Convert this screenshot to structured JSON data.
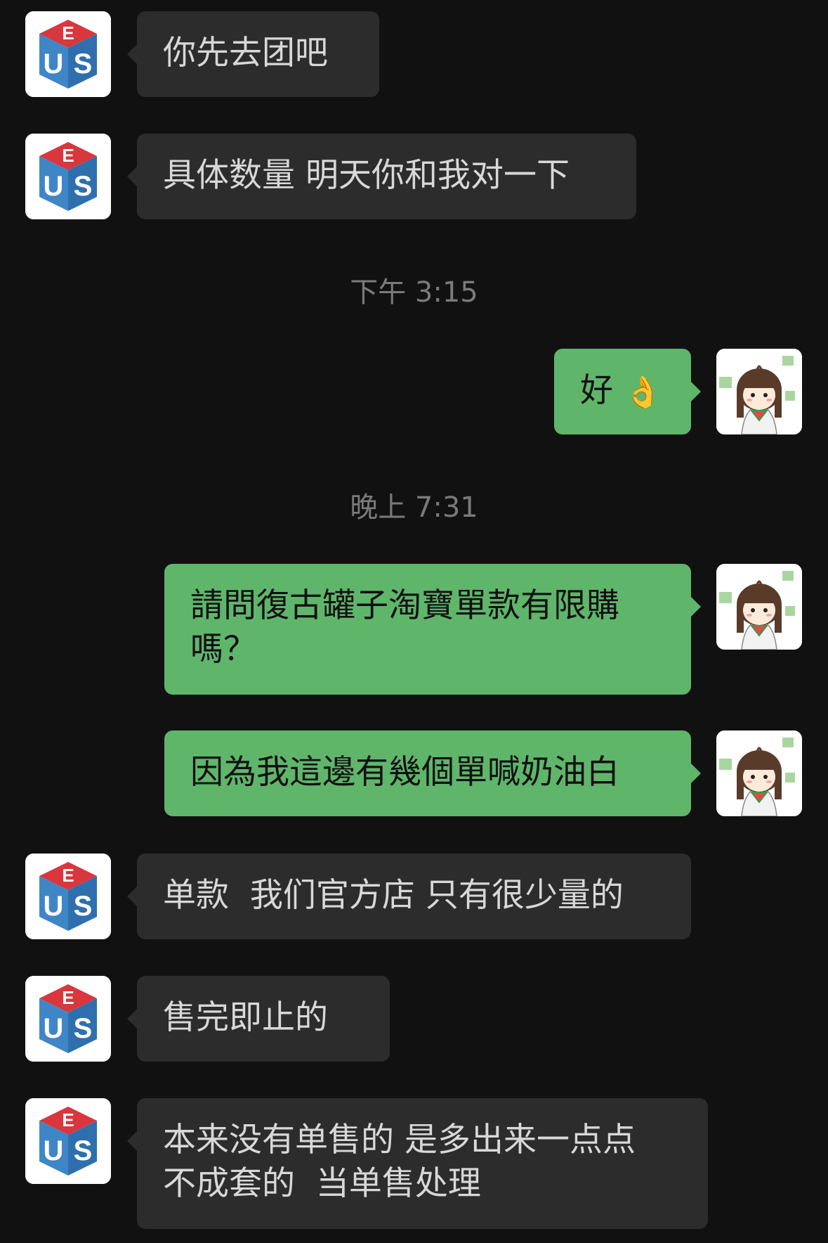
{
  "colors": {
    "background": "#111111",
    "incoming_bubble": "#2c2c2c",
    "outgoing_bubble": "#5fb66b",
    "incoming_text": "#d8d8d8",
    "outgoing_text": "#111111",
    "timestamp_text": "#7a7a7a"
  },
  "avatars": {
    "contact": "eus-cube-logo-avatar",
    "self": "cartoon-girl-avatar"
  },
  "messages": [
    {
      "sender": "contact",
      "text": "你先去团吧"
    },
    {
      "sender": "contact",
      "text": "具体数量 明天你和我对一下"
    },
    {
      "type": "timestamp",
      "text": "下午 3:15"
    },
    {
      "sender": "self",
      "text": "好",
      "emoji": "👌"
    },
    {
      "type": "timestamp",
      "text": "晚上 7:31"
    },
    {
      "sender": "self",
      "text_line1": "請問復古罐子淘寶單款有限購",
      "text_line2": "嗎？"
    },
    {
      "sender": "self",
      "text": "因為我這邊有幾個單喊奶油白"
    },
    {
      "sender": "contact",
      "text": "单款  我们官方店 只有很少量的"
    },
    {
      "sender": "contact",
      "text": "售完即止的"
    },
    {
      "sender": "contact",
      "text_line1": "本来没有单售的 是多出来一点点",
      "text_line2": "不成套的  当单售处理"
    }
  ]
}
